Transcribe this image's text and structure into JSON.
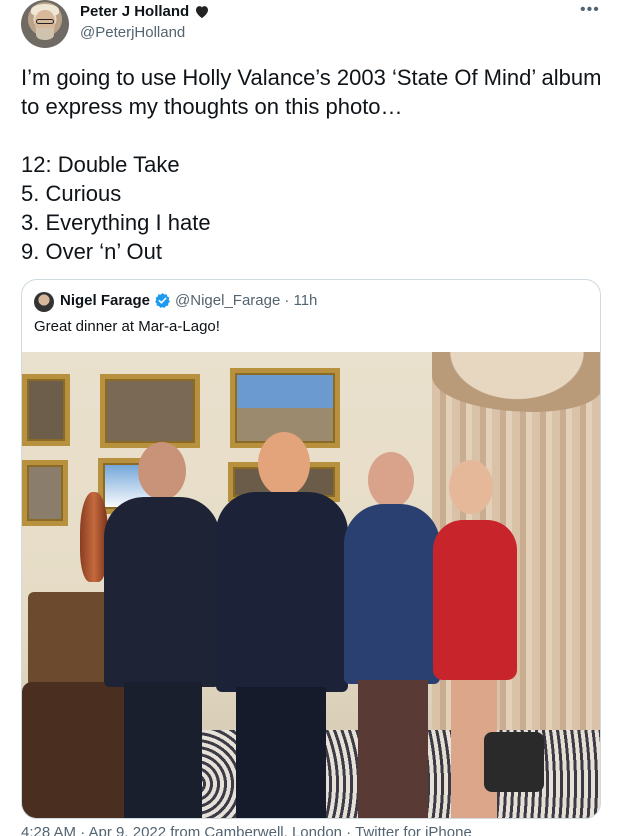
{
  "author": {
    "display_name": "Peter J Holland",
    "handle": "@PeterjHolland",
    "heart_color": "#222222"
  },
  "tweet": {
    "text": "I’m going to use Holly Valance’s 2003 ‘State Of Mind’ album to express my thoughts on this photo…\n\n12: Double Take\n5. Curious\n3. Everything I hate\n9. Over ‘n’ Out"
  },
  "quoted": {
    "display_name": "Nigel Farage",
    "handle": "@Nigel_Farage",
    "age": "· 11h",
    "text": "Great dinner at Mar-a-Lago!",
    "verified_color": "#1d9bf0"
  },
  "footer": {
    "meta": "4:28 AM · Apr 9, 2022 from Camberwell, London · Twitter for iPhone"
  },
  "icons": {
    "more": "more-icon",
    "heart": "heart-icon",
    "verified": "verified-icon"
  }
}
